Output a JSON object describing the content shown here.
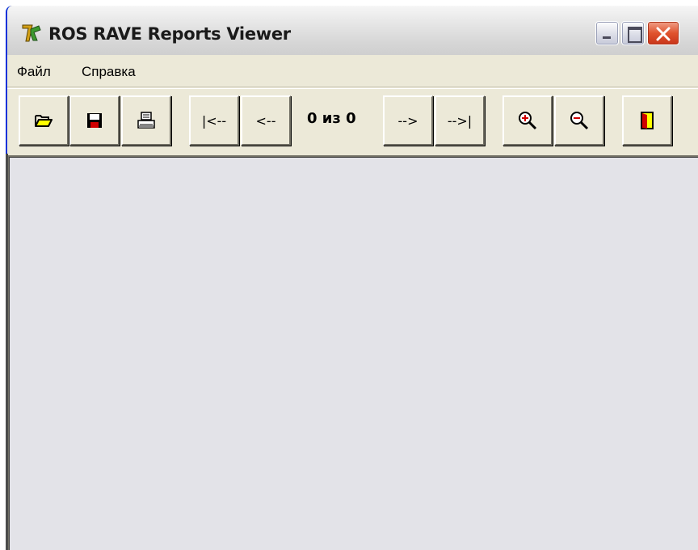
{
  "window": {
    "title": "ROS RAVE Reports Viewer",
    "app_icon": "rave-app-icon"
  },
  "caption_buttons": {
    "minimize": "minimize-icon",
    "maximize": "maximize-icon",
    "close": "close-icon"
  },
  "menu": {
    "file_label": "Файл",
    "help_label": "Справка"
  },
  "toolbar": {
    "open": {
      "icon": "folder-open-icon"
    },
    "save": {
      "icon": "floppy-save-icon"
    },
    "print": {
      "icon": "printer-icon"
    },
    "first_label": "|<--",
    "prev_label": "<--",
    "page_indicator": "0 из 0",
    "next_label": "-->",
    "last_label": "-->|",
    "zoom_in": {
      "icon": "zoom-in-icon"
    },
    "zoom_out": {
      "icon": "zoom-out-icon"
    },
    "exit": {
      "icon": "exit-door-icon"
    }
  },
  "colors": {
    "chrome": "#ece9d8",
    "client_area": "#e3e3e8",
    "close_button": "#e0532e"
  }
}
